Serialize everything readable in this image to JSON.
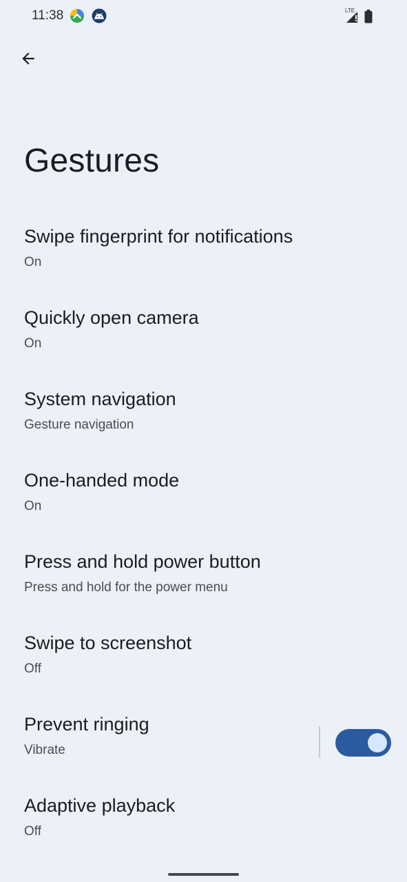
{
  "status_bar": {
    "time": "11:38",
    "icons_left": [
      "maps-app-icon",
      "android-app-icon"
    ],
    "network_label": "LTE",
    "icons_right": [
      "signal-icon",
      "battery-icon"
    ]
  },
  "header": {
    "back_icon": "arrow-back-icon",
    "title": "Gestures"
  },
  "settings": [
    {
      "title": "Swipe fingerprint for notifications",
      "summary": "On"
    },
    {
      "title": "Quickly open camera",
      "summary": "On"
    },
    {
      "title": "System navigation",
      "summary": "Gesture navigation"
    },
    {
      "title": "One-handed mode",
      "summary": "On"
    },
    {
      "title": "Press and hold power button",
      "summary": "Press and hold for the power menu"
    },
    {
      "title": "Swipe to screenshot",
      "summary": "Off"
    },
    {
      "title": "Prevent ringing",
      "summary": "Vibrate",
      "toggle_on": true
    },
    {
      "title": "Adaptive playback",
      "summary": "Off"
    }
  ],
  "colors": {
    "background": "#ecf1f8",
    "accent": "#2c5aa0",
    "toggle_thumb": "#d9e6ff"
  }
}
